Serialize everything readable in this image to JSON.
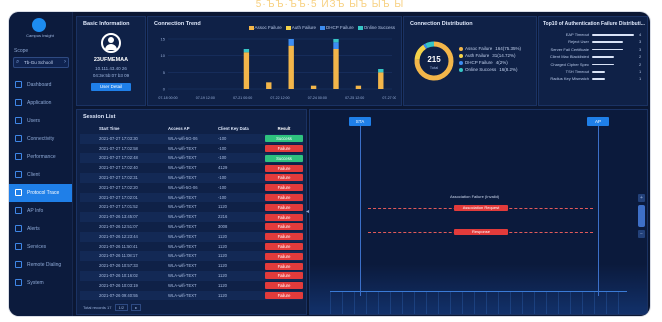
{
  "banner": {
    "text": "5·ЪЪ·ЪЪ·5 ИЗЪ ЫЪ ЫЪ Ы"
  },
  "sidebar": {
    "logo_text": "Campus Insight",
    "section_label": "Scope",
    "search_value": "Tb-Gu Schooll",
    "items": [
      {
        "label": "Dashboard"
      },
      {
        "label": "Application"
      },
      {
        "label": "Users"
      },
      {
        "label": "Connectivity"
      },
      {
        "label": "Performance"
      },
      {
        "label": "Client"
      },
      {
        "label": "Protocol Trace"
      },
      {
        "label": "AP Info"
      },
      {
        "label": "Alerts"
      },
      {
        "label": "Services"
      },
      {
        "label": "Remote Dialing"
      },
      {
        "label": "System"
      }
    ],
    "active_index": 6
  },
  "basic": {
    "title": "Basic Information",
    "user_name": "23UFMEMAA",
    "ip": "10.111.43.40 26",
    "mac": "04:3e:5b:07 b3 09",
    "button_label": "User Detail"
  },
  "trend": {
    "title": "Connection Trend",
    "legend": [
      {
        "label": "Assoc Failure",
        "color": "#f3b64a"
      },
      {
        "label": "Auth Failure",
        "color": "#f3d24a"
      },
      {
        "label": "DHCP Failure",
        "color": "#3d8df2"
      },
      {
        "label": "Online Success",
        "color": "#36c6c6"
      }
    ],
    "y_ticks": [
      "15",
      "10",
      "5",
      "0"
    ],
    "x_ticks": [
      "07-18 00:00",
      "07-19 12:00",
      "07-21 00:00",
      "07-22 12:00",
      "07-24 00:00",
      "07-25 12:00",
      "07-27 00:00"
    ]
  },
  "chart_data": {
    "type": "bar",
    "title": "Connection Trend",
    "x": [
      "07-18",
      "07-19",
      "07-20",
      "07-21",
      "07-22",
      "07-23",
      "07-24",
      "07-25",
      "07-26",
      "07-27"
    ],
    "series": [
      {
        "name": "Assoc Failure",
        "values": [
          0,
          0,
          0,
          11,
          2,
          13,
          1,
          12,
          1,
          5
        ]
      },
      {
        "name": "Auth Failure",
        "values": [
          0,
          0,
          0,
          0,
          0,
          0,
          0,
          0,
          0,
          0
        ]
      },
      {
        "name": "DHCP Failure",
        "values": [
          0,
          0,
          0,
          0,
          0,
          2,
          0,
          2,
          0,
          0
        ]
      },
      {
        "name": "Online Success",
        "values": [
          0,
          0,
          0,
          1,
          0,
          0,
          0,
          1,
          0,
          1
        ]
      }
    ],
    "ylim": [
      0,
      15
    ]
  },
  "distribution": {
    "title": "Connection Distribution",
    "total": "215",
    "total_label": "Total",
    "legend": [
      {
        "label": "Assoc Failure",
        "value": "164(75.35%)",
        "color": "#f3b64a"
      },
      {
        "label": "Auth Failure",
        "value": "31(14.72%)",
        "color": "#f3d24a"
      },
      {
        "label": "DHCP Failure",
        "value": "4(2%)",
        "color": "#3d8df2"
      },
      {
        "label": "Online Success",
        "value": "16(8.2%)",
        "color": "#36c6c6"
      }
    ]
  },
  "failure_top": {
    "title": "Top10 of Authentication Failure Distributi...",
    "rows": [
      {
        "label": "EAP Timeout",
        "count": "4",
        "pct": 0.95
      },
      {
        "label": "Reject User",
        "count": "3",
        "pct": 0.7
      },
      {
        "label": "Server Fail Certificate",
        "count": "3",
        "pct": 0.7
      },
      {
        "label": "Client Mac Blacklisted",
        "count": "2",
        "pct": 0.5
      },
      {
        "label": "Charged Cipher Spec",
        "count": "2",
        "pct": 0.5
      },
      {
        "label": "TSH Timeout",
        "count": "1",
        "pct": 0.3
      },
      {
        "label": "Radius Key Mismatch",
        "count": "1",
        "pct": 0.3
      }
    ]
  },
  "session": {
    "title": "Session List",
    "headers": [
      "Start Time",
      "Access AP",
      "Client Key Data",
      "Result"
    ],
    "rows": [
      {
        "time": "2021-07-27 17:03:30",
        "ap": "WLA-wifi-5G-06",
        "key": "-100",
        "result": "Success",
        "ok": true
      },
      {
        "time": "2021-07-27 17:02:58",
        "ap": "WLA-wifi-TEXT",
        "key": "-100",
        "result": "Failure",
        "ok": false
      },
      {
        "time": "2021-07-27 17:02:48",
        "ap": "WLA-wifi-TEXT",
        "key": "-100",
        "result": "Success",
        "ok": true
      },
      {
        "time": "2021-07-27 17:02:40",
        "ap": "WLA-wifi-TEXT",
        "key": "4129",
        "result": "Failure",
        "ok": false
      },
      {
        "time": "2021-07-27 17:02:31",
        "ap": "WLA-wifi-TEXT",
        "key": "-100",
        "result": "Failure",
        "ok": false
      },
      {
        "time": "2021-07-27 17:02:20",
        "ap": "WLA-wifi-5G-06",
        "key": "-100",
        "result": "Failure",
        "ok": false
      },
      {
        "time": "2021-07-27 17:02:01",
        "ap": "WLA-wifi-TEXT",
        "key": "-100",
        "result": "Failure",
        "ok": false
      },
      {
        "time": "2021-07-27 17:01:52",
        "ap": "WLA-wifi-TEXT",
        "key": "1120",
        "result": "Failure",
        "ok": false
      },
      {
        "time": "2021-07-26 13:45:07",
        "ap": "WLA-wifi-TEXT",
        "key": "2216",
        "result": "Failure",
        "ok": false
      },
      {
        "time": "2021-07-26 12:51:07",
        "ap": "WLA-wifi-TEXT",
        "key": "3008",
        "result": "Failure",
        "ok": false
      },
      {
        "time": "2021-07-26 12:23:44",
        "ap": "WLA-wifi-TEXT",
        "key": "1120",
        "result": "Failure",
        "ok": false
      },
      {
        "time": "2021-07-26 11:50:41",
        "ap": "WLA-wifi-TEXT",
        "key": "1120",
        "result": "Failure",
        "ok": false
      },
      {
        "time": "2021-07-26 11:08:17",
        "ap": "WLA-wifi-TEXT",
        "key": "1120",
        "result": "Failure",
        "ok": false
      },
      {
        "time": "2021-07-26 10:57:33",
        "ap": "WLA-wifi-TEXT",
        "key": "1120",
        "result": "Failure",
        "ok": false
      },
      {
        "time": "2021-07-26 10:16:02",
        "ap": "WLA-wifi-TEXT",
        "key": "1120",
        "result": "Failure",
        "ok": false
      },
      {
        "time": "2021-07-26 10:03:19",
        "ap": "WLA-wifi-TEXT",
        "key": "1120",
        "result": "Failure",
        "ok": false
      },
      {
        "time": "2021-07-26 09:40:55",
        "ap": "WLA-wifi-TEXT",
        "key": "1120",
        "result": "Failure",
        "ok": false
      }
    ],
    "pager_label": "Total records 17",
    "pager_page": "1/2",
    "pager_next": "▸"
  },
  "flow": {
    "left_node": "STA",
    "right_node": "AP",
    "caption": "Association Failure (Invalid)",
    "msg1": "Association Request",
    "msg2": "Response"
  }
}
